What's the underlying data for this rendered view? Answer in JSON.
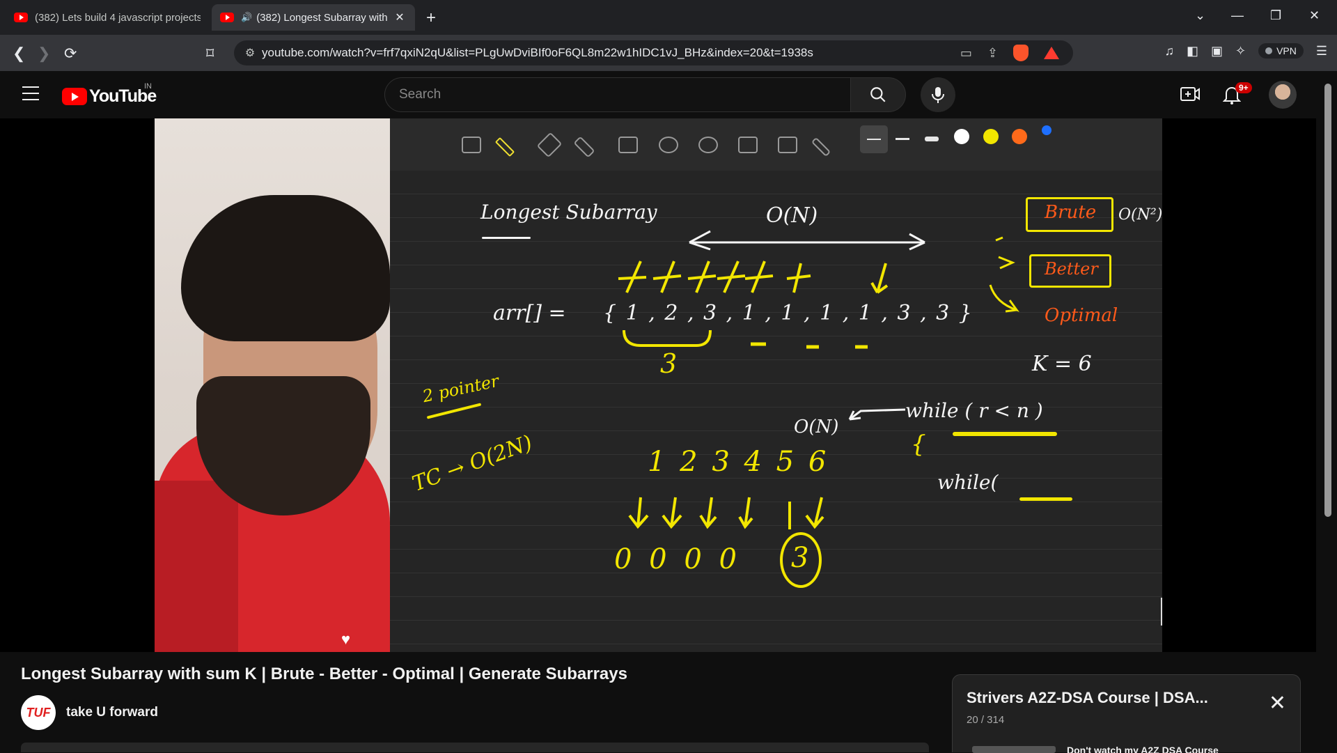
{
  "browser": {
    "tabs": [
      {
        "label": "(382) Lets build 4 javascript projects",
        "active": false
      },
      {
        "label": "(382) Longest Subarray with",
        "active": true
      }
    ],
    "url": "youtube.com/watch?v=frf7qxiN2qU&list=PLgUwDviBIf0oF6QL8m22w1hIDC1vJ_BHz&index=20&t=1938s",
    "vpn_label": "VPN"
  },
  "youtube": {
    "logo_text": "YouTube",
    "country": "IN",
    "search_placeholder": "Search",
    "notification_count": "9+"
  },
  "whiteboard": {
    "heading": "Longest Subarray",
    "complexity_top": "O(N)",
    "brute": "Brute",
    "brute_complexity": "O(N²)",
    "better": "Better",
    "optimal": "Optimal",
    "array_label": "arr[] =",
    "array_values": "{ 1 , 2 , 3 , 1 , 1 , 1 , 1 , 3 , 3 }",
    "brace_sum": "3",
    "k_value": "K = 6",
    "two_pointer": "2 pointer",
    "tc": "TC → O(2N)",
    "complexity_mid": "O(N)",
    "while_outer": "while ( r < n )",
    "brace_open": "{",
    "while_inner": "while(",
    "index_row": "1   2 3   4   5   6",
    "zero_row": "0   0   0   0",
    "circled_value": "3"
  },
  "video": {
    "title": "Longest Subarray with sum K | Brute - Better - Optimal | Generate Subarrays",
    "channel": "take U forward",
    "channel_logo_text": "TUF"
  },
  "playlist": {
    "title": "Strivers A2Z-DSA Course | DSA...",
    "position": "20 / 314",
    "next_text": "Don't watch my A2Z DSA Course"
  },
  "colors": {
    "youtube_red": "#ff0000",
    "ink_yellow": "#f2e600",
    "ink_orange": "#ff5a1a",
    "board_bg": "#252525"
  }
}
